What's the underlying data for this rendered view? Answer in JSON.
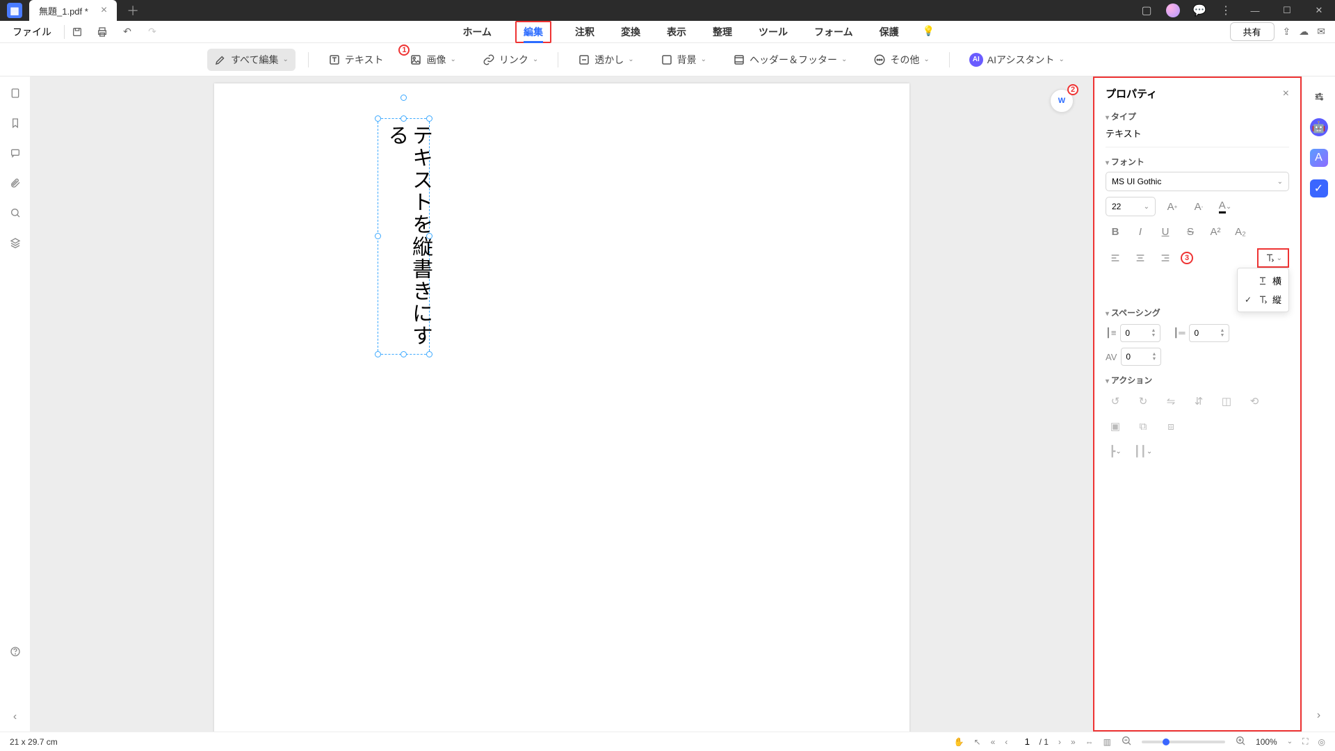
{
  "titlebar": {
    "tab_name": "無題_1.pdf *"
  },
  "menubar": {
    "file": "ファイル",
    "tabs": [
      "ホーム",
      "編集",
      "注釈",
      "変換",
      "表示",
      "整理",
      "ツール",
      "フォーム",
      "保護"
    ],
    "active_index": 1,
    "share": "共有"
  },
  "toolbar": {
    "edit_all": "すべて編集",
    "text": "テキスト",
    "image": "画像",
    "link": "リンク",
    "watermark": "透かし",
    "background": "背景",
    "header_footer": "ヘッダー＆フッター",
    "other": "その他",
    "ai_assistant": "AIアシスタント"
  },
  "annotations": {
    "n1": "1",
    "n2": "2",
    "n3": "3"
  },
  "canvas": {
    "text_content": "テキストを縦書きにする",
    "float_label": "W"
  },
  "properties": {
    "title": "プロパティ",
    "type_label": "タイプ",
    "type_value": "テキスト",
    "font_label": "フォント",
    "font_name": "MS UI Gothic",
    "font_size": "22",
    "spacing_label": "スペーシング",
    "line_spacing": "0",
    "para_spacing": "0",
    "char_spacing": "0",
    "action_label": "アクション",
    "direction": {
      "horizontal": "横",
      "vertical": "縦"
    }
  },
  "statusbar": {
    "dimensions": "21 x 29.7 cm",
    "page_current": "1",
    "page_total": "/ 1",
    "zoom": "100%"
  }
}
